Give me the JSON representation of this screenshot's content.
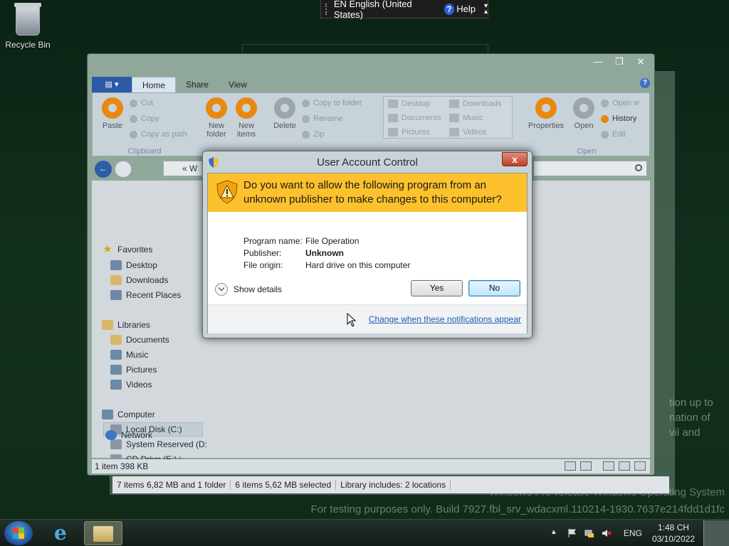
{
  "desktop": {
    "recycle_bin_label": "Recycle Bin",
    "watermark_line1": "Windows Pre-release Windows Operating System",
    "watermark_line2": "For testing purposes only. Build 7927.fbl_srv_wdacxml.110214-1930.7637e214fdd1d1fc",
    "bg_text_1": "tion up to",
    "bg_text_2": "nation of",
    "bg_text_3": "vil and"
  },
  "language_bar": {
    "language": "EN English (United States)",
    "help_label": "Help"
  },
  "explorer": {
    "window_controls": {
      "minimize": "—",
      "maximize": "❐",
      "close": "✕"
    },
    "ribbon_tabs": [
      "Home",
      "Share",
      "View"
    ],
    "ribbon": {
      "clipboard": {
        "paste": "Paste",
        "cut": "Cut",
        "copy": "Copy",
        "copy_as_path": "Copy as path",
        "group_label": "Clipboard"
      },
      "new": {
        "new_folder": "New folder",
        "new_items": "New items"
      },
      "organize": {
        "delete": "Delete",
        "copy_to_folder": "Copy to folder",
        "rename": "Rename",
        "zip": "Zip"
      },
      "gallery": {
        "desktop": "Desktop",
        "downloads": "Downloads",
        "documents": "Documents",
        "music": "Music",
        "pictures": "Pictures",
        "videos": "Videos"
      },
      "open": {
        "properties": "Properties",
        "open": "Open",
        "open_with": "Open w",
        "history": "History",
        "edit": "Edit",
        "group_label": "Open"
      }
    },
    "address": {
      "path": "« W"
    },
    "nav": {
      "favorites": "Favorites",
      "desktop": "Desktop",
      "downloads": "Downloads",
      "recent_places": "Recent Places",
      "libraries": "Libraries",
      "documents": "Documents",
      "music": "Music",
      "pictures": "Pictures",
      "videos": "Videos",
      "computer": "Computer",
      "local_disk": "Local Disk (C:)",
      "system_reserved": "System Reserved (D:",
      "cd_drive": "CD Drive (E:) i",
      "network": "Network"
    },
    "status": "1 item 398 KB",
    "back_window_status": {
      "items": "7 items 6,82 MB and 1 folder",
      "selected": "6 items 5,62 MB selected",
      "library": "Library includes:  2 locations"
    }
  },
  "uac": {
    "title": "User Account Control",
    "close_label": "x",
    "question": "Do you want to allow the following program from an unknown publisher to make changes to this computer?",
    "program_name_label": "Program name:",
    "program_name_value": "File Operation",
    "publisher_label": "Publisher:",
    "publisher_value": "Unknown",
    "file_origin_label": "File origin:",
    "file_origin_value": "Hard drive on this computer",
    "show_details": "Show details",
    "yes": "Yes",
    "no": "No",
    "change_link": "Change when these notifications appear",
    "banner_color": "#fcc12c"
  },
  "taskbar": {
    "language": "ENG",
    "time": "1:48 CH",
    "date": "03/10/2022"
  }
}
